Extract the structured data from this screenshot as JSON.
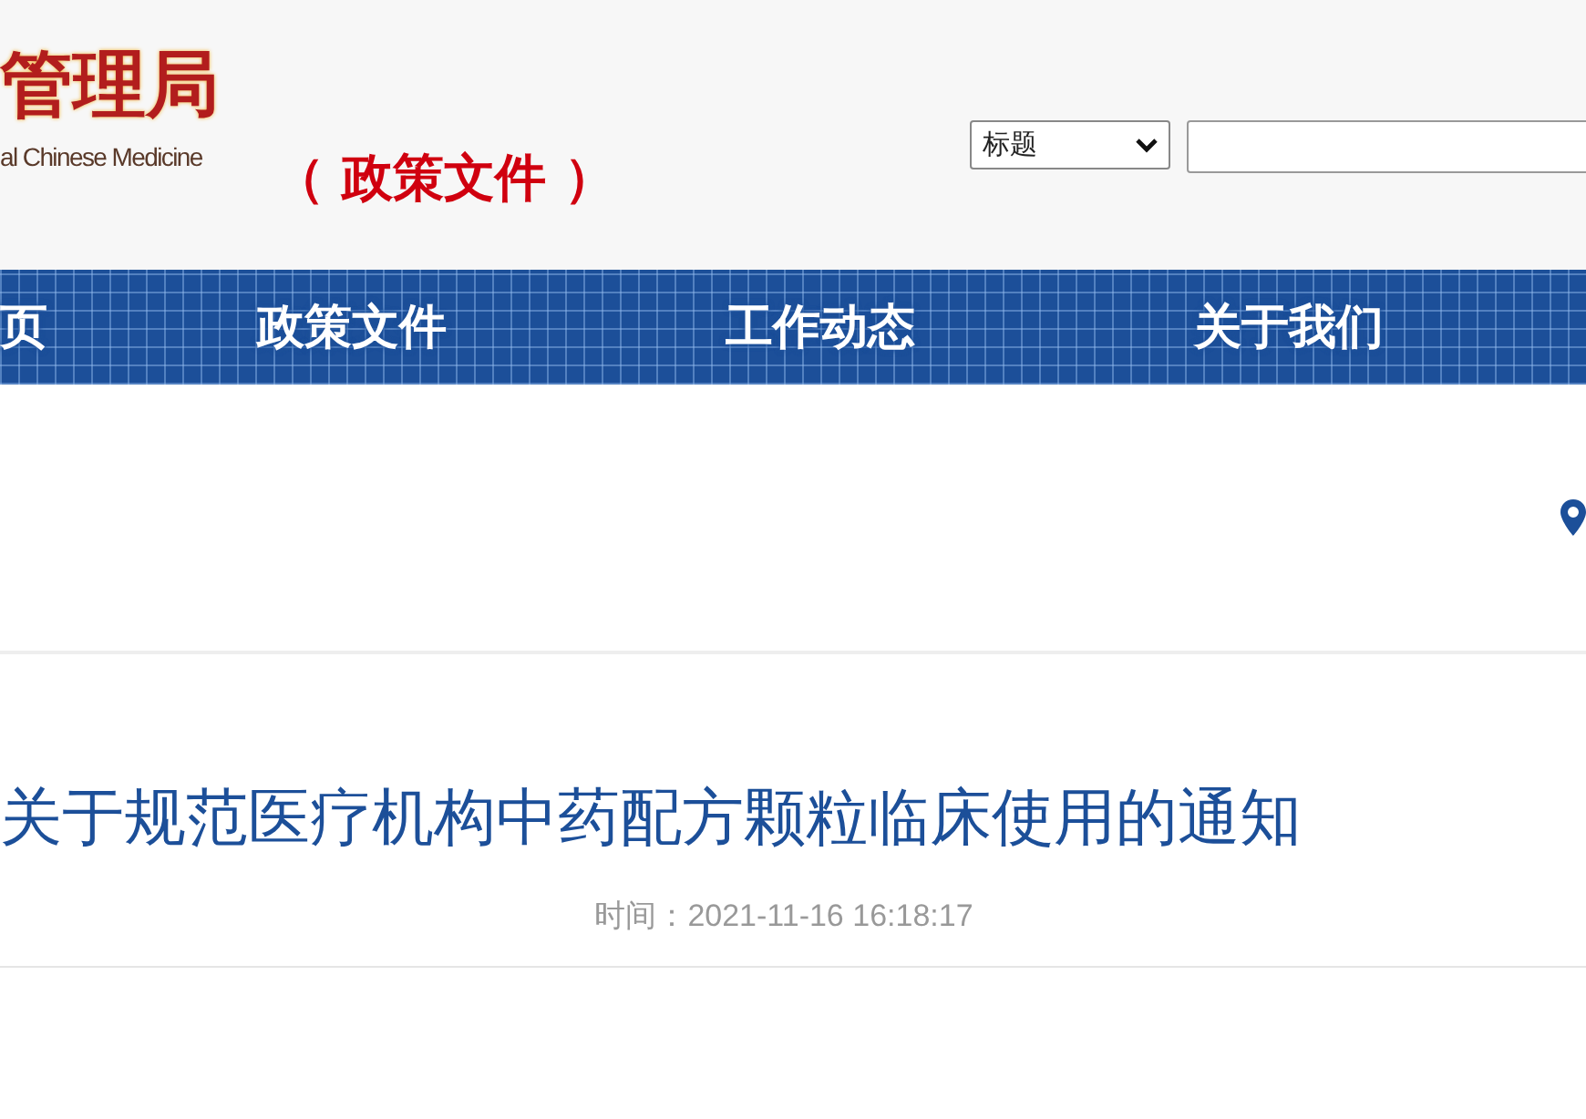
{
  "header": {
    "logo_title": "管理局",
    "logo_subtitle": "al Chinese Medicine",
    "section": "（ 政策文件 ）",
    "search": {
      "field_select": "标题"
    }
  },
  "nav": [
    {
      "label": "页"
    },
    {
      "label": "政策文件"
    },
    {
      "label": "工作动态"
    },
    {
      "label": "关于我们"
    }
  ],
  "article": {
    "title": "关于规范医疗机构中药配方颗粒临床使用的通知",
    "time": "时间：2021-11-16 16:18:17"
  }
}
